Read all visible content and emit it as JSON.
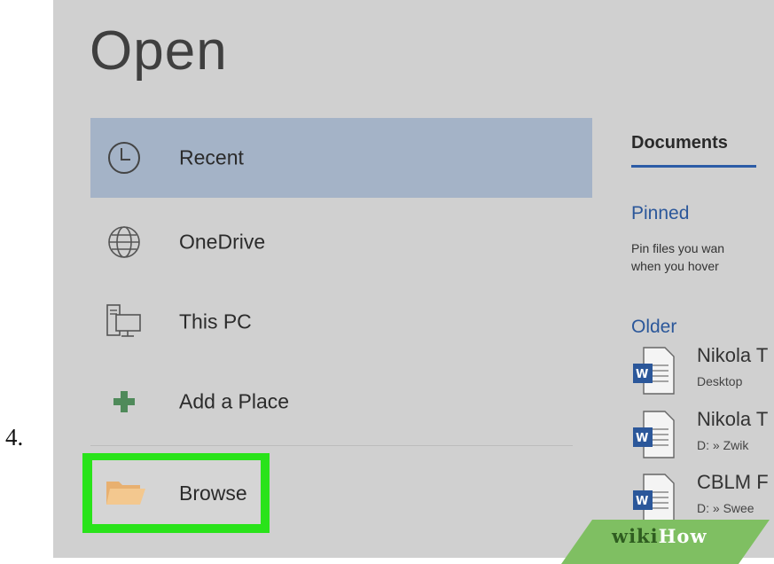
{
  "step": {
    "number": "4."
  },
  "screen": {
    "title": "Open",
    "nav": {
      "recent": {
        "label": "Recent",
        "icon": "clock-icon",
        "selected": true
      },
      "onedrive": {
        "label": "OneDrive",
        "icon": "globe-icon"
      },
      "thispc": {
        "label": "This PC",
        "icon": "computer-icon"
      },
      "addplace": {
        "label": "Add a Place",
        "icon": "plus-icon"
      },
      "browse": {
        "label": "Browse",
        "icon": "folder-icon",
        "highlighted": true
      }
    },
    "right": {
      "tab": "Documents",
      "pinned": {
        "heading": "Pinned",
        "line1": "Pin files you wan",
        "line2": "when you hover"
      },
      "older": {
        "heading": "Older",
        "docs": [
          {
            "name": "Nikola T",
            "path": "Desktop"
          },
          {
            "name": "Nikola T",
            "path": "D: » Zwik"
          },
          {
            "name": "CBLM F",
            "path": "D: » Swee"
          }
        ]
      }
    }
  },
  "watermark": {
    "part1": "wiki",
    "part2": "How"
  },
  "colors": {
    "selected_bg": "#a4b3c7",
    "highlight_frame": "#29e31a",
    "accent_blue": "#2b579a",
    "panel_bg": "#d0d0d0"
  }
}
